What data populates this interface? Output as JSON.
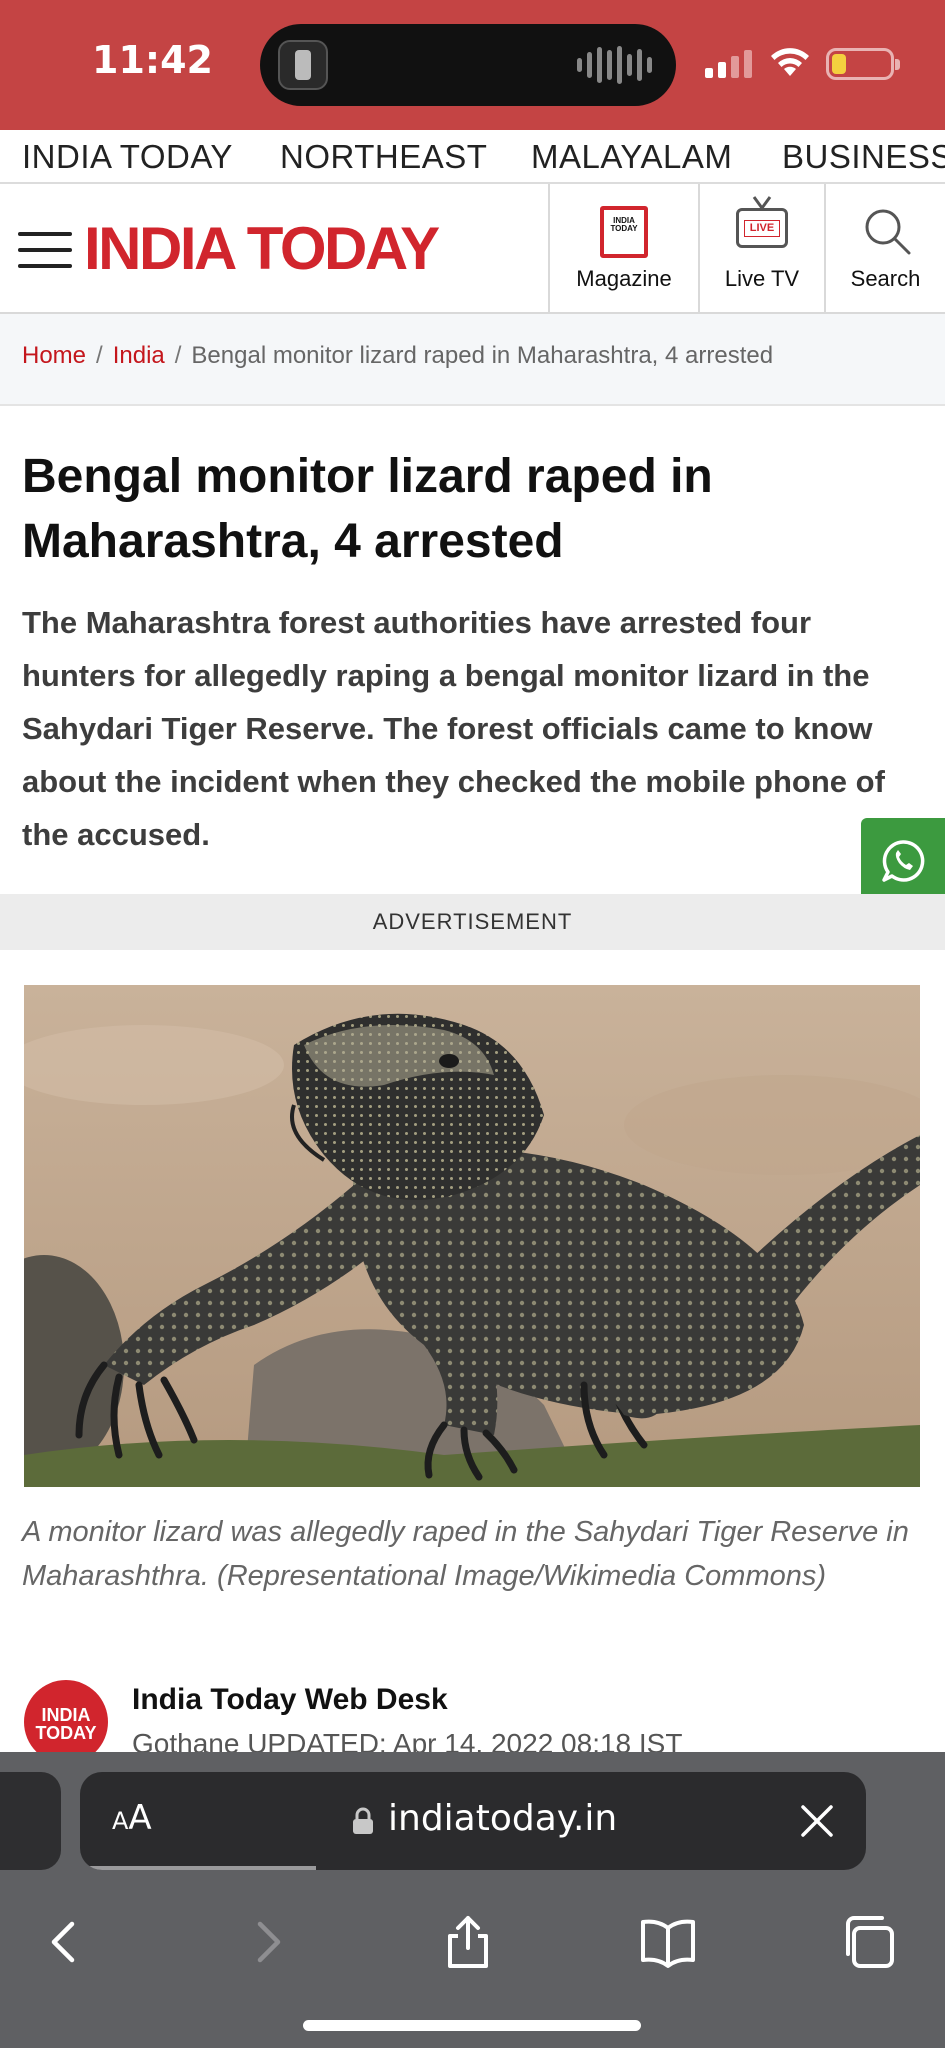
{
  "status_bar": {
    "time": "11:42",
    "battery_level": 0.25,
    "colors": {
      "background": "#c44444"
    }
  },
  "top_nav": {
    "items": [
      "INDIA TODAY",
      "NORTHEAST",
      "MALAYALAM",
      "BUSINESS"
    ]
  },
  "header": {
    "logo_text": "INDIA TODAY",
    "magazine_label": "Magazine",
    "live_tv_label": "Live TV",
    "live_badge": "LIVE",
    "search_label": "Search",
    "brand_color": "#d1252d"
  },
  "breadcrumb": {
    "home": "Home",
    "section": "India",
    "separator": "/",
    "current": "Bengal monitor lizard raped in Maharashtra, 4 arrested"
  },
  "article": {
    "headline": "Bengal monitor lizard raped in Maharashtra, 4 arrested",
    "summary": "The Maharashtra forest authorities have arrested four hunters for allegedly raping a bengal monitor lizard in the Sahydari Tiger Reserve. The forest officials came to know about the incident when they checked the mobile phone of the accused.",
    "advertisement_label": "ADVERTISEMENT",
    "image_caption": "A monitor lizard was allegedly raped in the Sahydari Tiger Reserve in Maharashthra. (Representational Image/Wikimedia Commons)",
    "author": {
      "logo_text": "INDIA TODAY",
      "name": "India Today Web Desk",
      "meta": "Gothane  UPDATED: Apr 14, 2022 08:18 IST"
    }
  },
  "browser": {
    "text_size_label_small": "A",
    "text_size_label_large": "A",
    "url": "indiatoday.in",
    "load_progress": 0.3,
    "toolbar_icons": [
      "back-icon",
      "forward-icon",
      "share-icon",
      "bookmarks-icon",
      "tabs-icon"
    ]
  }
}
